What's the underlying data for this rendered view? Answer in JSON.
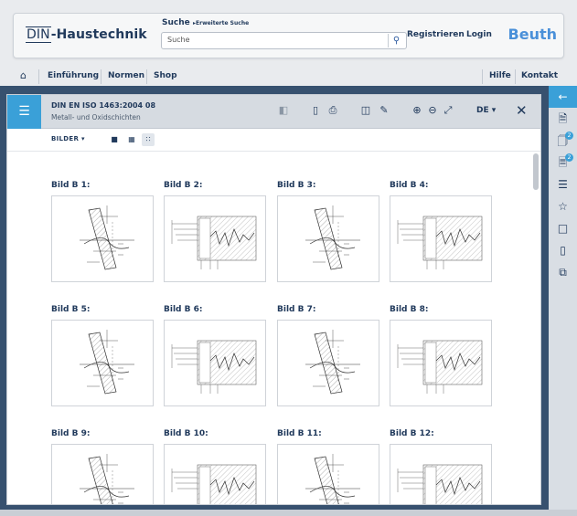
{
  "header": {
    "logo_din": "DIN",
    "logo_rest": "-Haustechnik",
    "search_title": "Suche",
    "search_advanced": "Erweiterte Suche",
    "search_placeholder": "Suche",
    "register": "Registrieren",
    "login": "Login",
    "brand_right": "Beuth"
  },
  "nav": {
    "items": [
      "Einführung",
      "Normen",
      "Shop"
    ],
    "right": [
      "Hilfe",
      "Kontakt"
    ]
  },
  "viewer": {
    "doc_id": "DIN EN ISO 1463:2004 08",
    "doc_subtitle": "Metall- und Oxidschichten",
    "lang": "DE",
    "view_label": "BILDER"
  },
  "figures": [
    {
      "title": "Bild B 1:",
      "kind": "a"
    },
    {
      "title": "Bild B 2:",
      "kind": "b"
    },
    {
      "title": "Bild B 3:",
      "kind": "a"
    },
    {
      "title": "Bild B 4:",
      "kind": "b"
    },
    {
      "title": "Bild B 5:",
      "kind": "a"
    },
    {
      "title": "Bild B 6:",
      "kind": "b"
    },
    {
      "title": "Bild B 7:",
      "kind": "a"
    },
    {
      "title": "Bild B 8:",
      "kind": "b"
    },
    {
      "title": "Bild B 9:",
      "kind": "a"
    },
    {
      "title": "Bild B 10:",
      "kind": "b"
    },
    {
      "title": "Bild B 11:",
      "kind": "a"
    },
    {
      "title": "Bild B 12:",
      "kind": "b"
    }
  ],
  "rail": {
    "badges": [
      "2",
      "2"
    ]
  },
  "colors": {
    "accent": "#3aa0d8",
    "navy": "#213a5c",
    "band": "#37516f"
  }
}
